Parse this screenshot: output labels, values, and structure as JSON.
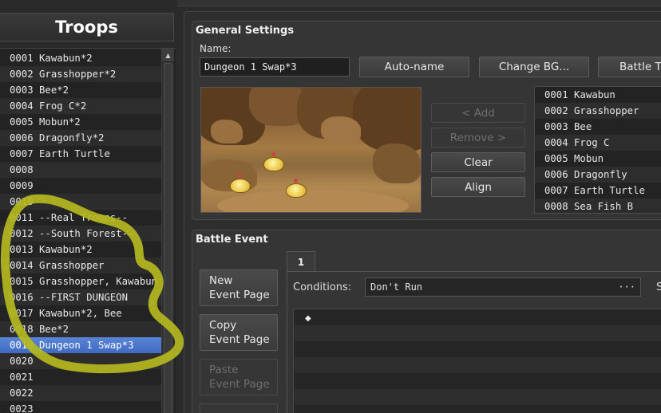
{
  "troops": {
    "header": "Troops",
    "items": [
      "0001 Kawabun*2",
      "0002 Grasshopper*2",
      "0003 Bee*2",
      "0004 Frog C*2",
      "0005 Mobun*2",
      "0006 Dragonfly*2",
      "0007 Earth Turtle",
      "0008",
      "0009",
      "0010",
      "0011 --Real Troops--",
      "0012 --South Forest--",
      "0013 Kawabun*2",
      "0014 Grasshopper",
      "0015 Grasshopper, Kawabun",
      "0016 --FIRST DUNGEON",
      "0017 Kawabun*2, Bee",
      "0018 Bee*2",
      "0019 Dungeon 1 Swap*3",
      "0020",
      "0021",
      "0022",
      "0023"
    ],
    "selected_index": 18,
    "scroll_up_glyph": "▲"
  },
  "general": {
    "title": "General Settings",
    "name_label": "Name:",
    "name_value": "Dungeon 1 Swap*3",
    "auto_name": "Auto-name",
    "change_bg": "Change BG...",
    "battle_test": "Battle T",
    "add": "< Add",
    "remove": "Remove >",
    "clear": "Clear",
    "align": "Align",
    "enemies": [
      "0001 Kawabun",
      "0002 Grasshopper",
      "0003 Bee",
      "0004 Frog C",
      "0005 Mobun",
      "0006 Dragonfly",
      "0007 Earth Turtle",
      "0008 Sea Fish B"
    ]
  },
  "battle_event": {
    "title": "Battle Event",
    "new_page": [
      "New",
      "Event Page"
    ],
    "copy_page": [
      "Copy",
      "Event Page"
    ],
    "paste_page": [
      "Paste",
      "Event Page"
    ],
    "tab_label": "1",
    "conditions_label": "Conditions:",
    "conditions_value": "Don't Run",
    "conditions_dots": "···",
    "span_label": "S",
    "command_marker": "◆"
  },
  "colors": {
    "selection": "#4a78cc",
    "annotation": "#b8b820"
  }
}
